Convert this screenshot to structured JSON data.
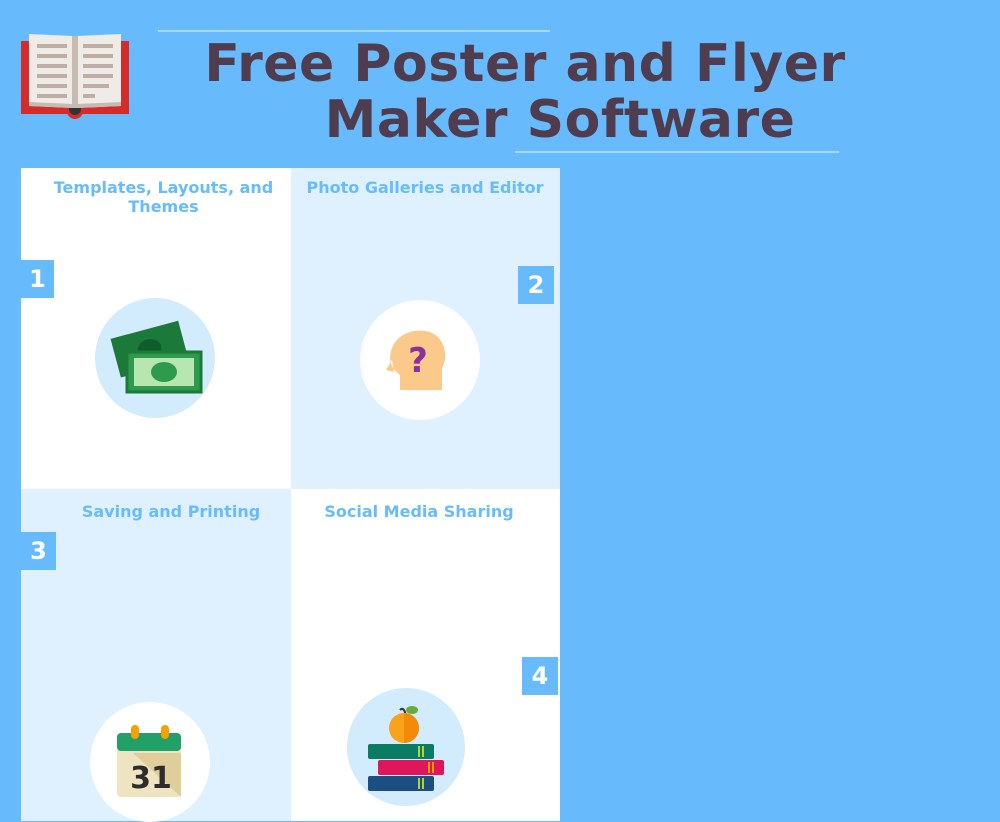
{
  "header": {
    "title_line1": "Free Poster and Flyer",
    "title_line2": "Maker Software",
    "logo_icon": "open-book-icon"
  },
  "colors": {
    "background": "#67bbfd",
    "title": "#4f3c4f",
    "section_title": "#68bcfc",
    "panel_light": "#dff0fe",
    "panel_white": "#ffffff"
  },
  "sections": [
    {
      "number": "1",
      "title": "Templates, Layouts, and Themes",
      "icon": "money-icon"
    },
    {
      "number": "2",
      "title": "Photo Galleries and Editor",
      "icon": "head-question-icon"
    },
    {
      "number": "3",
      "title": "Saving and Printing",
      "icon": "calendar-icon",
      "icon_text": "31"
    },
    {
      "number": "4",
      "title": "Social Media Sharing",
      "icon": "books-apple-icon"
    }
  ]
}
